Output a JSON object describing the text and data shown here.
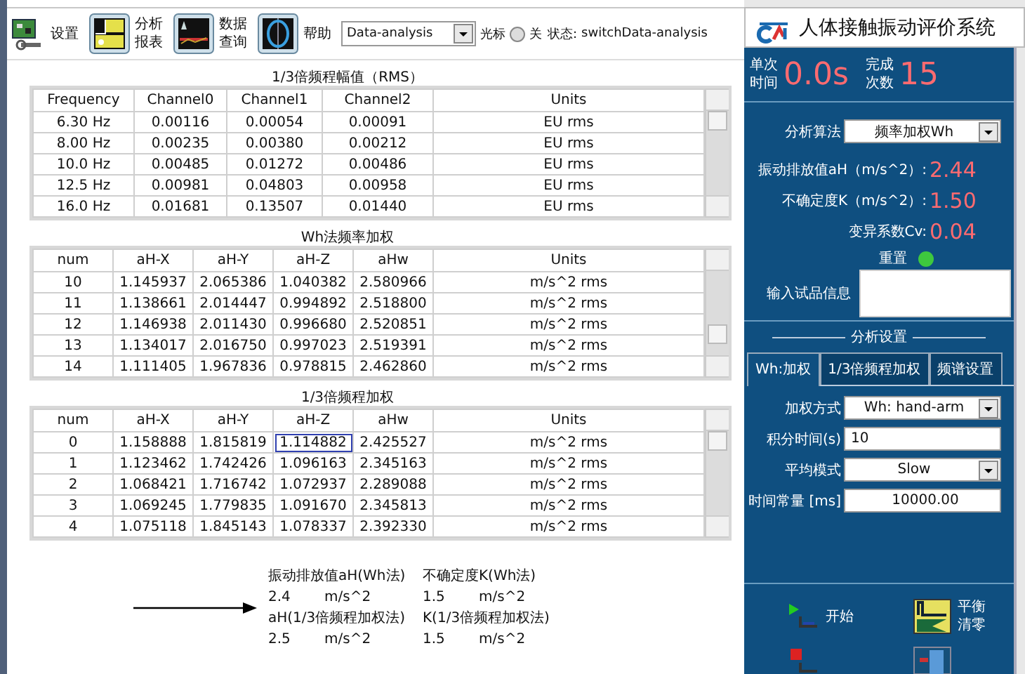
{
  "toolbar": {
    "buttons": [
      {
        "kind": "settings",
        "lines": [
          "设置"
        ]
      },
      {
        "kind": "report",
        "lines": [
          "分析",
          "报表"
        ]
      },
      {
        "kind": "query",
        "lines": [
          "数据",
          "查询"
        ]
      },
      {
        "kind": "help",
        "lines": [
          "帮助"
        ]
      }
    ],
    "mode_select": {
      "value": "Data-analysis"
    },
    "cursor": {
      "label": "光标",
      "on": false,
      "state_label": "关"
    },
    "status": {
      "label": "状态:",
      "value": "switchData-analysis"
    }
  },
  "tables": [
    {
      "title": "1/3倍频程幅值（RMS）",
      "columns": [
        "Frequency",
        "Channel0",
        "Channel1",
        "Channel2",
        "Units"
      ],
      "rows": [
        [
          "6.30 Hz",
          "0.00116",
          "0.00054",
          "0.00091",
          "EU rms"
        ],
        [
          "8.00 Hz",
          "0.00235",
          "0.00380",
          "0.00212",
          "EU rms"
        ],
        [
          "10.0 Hz",
          "0.00485",
          "0.01272",
          "0.00486",
          "EU rms"
        ],
        [
          "12.5 Hz",
          "0.00981",
          "0.04803",
          "0.00958",
          "EU rms"
        ],
        [
          "16.0 Hz",
          "0.01681",
          "0.13507",
          "0.01440",
          "EU rms"
        ]
      ]
    },
    {
      "title": "Wh法频率加权",
      "columns": [
        "num",
        "aH-X",
        "aH-Y",
        "aH-Z",
        "aHw",
        "Units"
      ],
      "rows": [
        [
          "10",
          "1.145937",
          "2.065386",
          "1.040382",
          "2.580966",
          "m/s^2 rms"
        ],
        [
          "11",
          "1.138661",
          "2.014447",
          "0.994892",
          "2.518800",
          "m/s^2 rms"
        ],
        [
          "12",
          "1.146938",
          "2.011430",
          "0.996680",
          "2.520851",
          "m/s^2 rms"
        ],
        [
          "13",
          "1.134017",
          "2.016750",
          "0.997023",
          "2.519391",
          "m/s^2 rms"
        ],
        [
          "14",
          "1.111405",
          "1.967836",
          "0.978815",
          "2.462860",
          "m/s^2 rms"
        ]
      ]
    },
    {
      "title": "1/3倍频程加权",
      "columns": [
        "num",
        "aH-X",
        "aH-Y",
        "aH-Z",
        "aHw",
        "Units"
      ],
      "rows": [
        [
          {
            "text": "0",
            "selected": false
          },
          {
            "text": "1.158888",
            "selected": false
          },
          {
            "text": "1.815819",
            "selected": false
          },
          {
            "text": "1.114882",
            "selected": true
          },
          {
            "text": "2.425527",
            "selected": false
          },
          {
            "text": "m/s^2 rms",
            "selected": false
          }
        ],
        [
          {
            "text": "1",
            "selected": false
          },
          {
            "text": "1.123462",
            "selected": false
          },
          {
            "text": "1.742426",
            "selected": false
          },
          {
            "text": "1.096163",
            "selected": false
          },
          {
            "text": "2.345163",
            "selected": false
          },
          {
            "text": "m/s^2 rms",
            "selected": false
          }
        ],
        [
          {
            "text": "2",
            "selected": false
          },
          {
            "text": "1.068421",
            "selected": false
          },
          {
            "text": "1.716742",
            "selected": false
          },
          {
            "text": "1.072937",
            "selected": false
          },
          {
            "text": "2.289088",
            "selected": false
          },
          {
            "text": "m/s^2 rms",
            "selected": false
          }
        ],
        [
          {
            "text": "3",
            "selected": false
          },
          {
            "text": "1.069245",
            "selected": false
          },
          {
            "text": "1.779835",
            "selected": false
          },
          {
            "text": "1.091670",
            "selected": false
          },
          {
            "text": "2.345813",
            "selected": false
          },
          {
            "text": "m/s^2 rms",
            "selected": false
          }
        ],
        [
          {
            "text": "4",
            "selected": false
          },
          {
            "text": "1.075118",
            "selected": false
          },
          {
            "text": "1.845143",
            "selected": false
          },
          {
            "text": "1.078337",
            "selected": false
          },
          {
            "text": "2.392330",
            "selected": false
          },
          {
            "text": "m/s^2 rms",
            "selected": false
          }
        ]
      ]
    }
  ],
  "results": [
    {
      "label": "振动排放值aH(Wh法)",
      "value": "2.4",
      "unit": "m/s^2"
    },
    {
      "label": "不确定度K(Wh法)",
      "value": "1.5",
      "unit": "m/s^2"
    },
    {
      "label": "aH(1/3倍频程加权法)",
      "value": "2.5",
      "unit": "m/s^2"
    },
    {
      "label": "K(1/3倍频程加权法)",
      "value": "1.5",
      "unit": "m/s^2"
    }
  ],
  "panel": {
    "title": "人体接触振动评价系统",
    "counters": [
      {
        "label": [
          "单次",
          "时间"
        ],
        "value": "0.0s"
      },
      {
        "label": [
          "完成",
          "次数"
        ],
        "value": "15"
      }
    ],
    "algorithm": {
      "label": "分析算法",
      "value": "频率加权Wh"
    },
    "readings": [
      {
        "label": "振动排放值aH（m/s^2）:",
        "value": "2.44"
      },
      {
        "label": "不确定度K（m/s^2）:",
        "value": "1.50"
      },
      {
        "label": "变异系数Cv:",
        "value": "0.04"
      }
    ],
    "reset": {
      "label": "重置",
      "on": true
    },
    "sample_info": {
      "label": "输入试品信息"
    },
    "settings": {
      "title": "分析设置",
      "tabs": [
        {
          "label": "Wh:加权",
          "selected": true
        },
        {
          "label": "1/3倍频程加权",
          "selected": false
        },
        {
          "label": "频谱设置",
          "selected": false
        }
      ],
      "fields": [
        {
          "kind": "select",
          "label": "加权方式",
          "value": "Wh: hand-arm"
        },
        {
          "kind": "input",
          "label": "积分时间(s)",
          "value": "10"
        },
        {
          "kind": "select",
          "label": "平均模式",
          "value": "Slow"
        },
        {
          "kind": "number",
          "label": "时间常量 [ms]",
          "value": "10000.00"
        }
      ]
    },
    "actions": [
      {
        "kind": "start",
        "lines": [
          "开始"
        ]
      },
      {
        "kind": "balance",
        "lines": [
          "平衡",
          "清零"
        ]
      },
      {
        "kind": "stop"
      },
      {
        "kind": "exit"
      }
    ]
  }
}
